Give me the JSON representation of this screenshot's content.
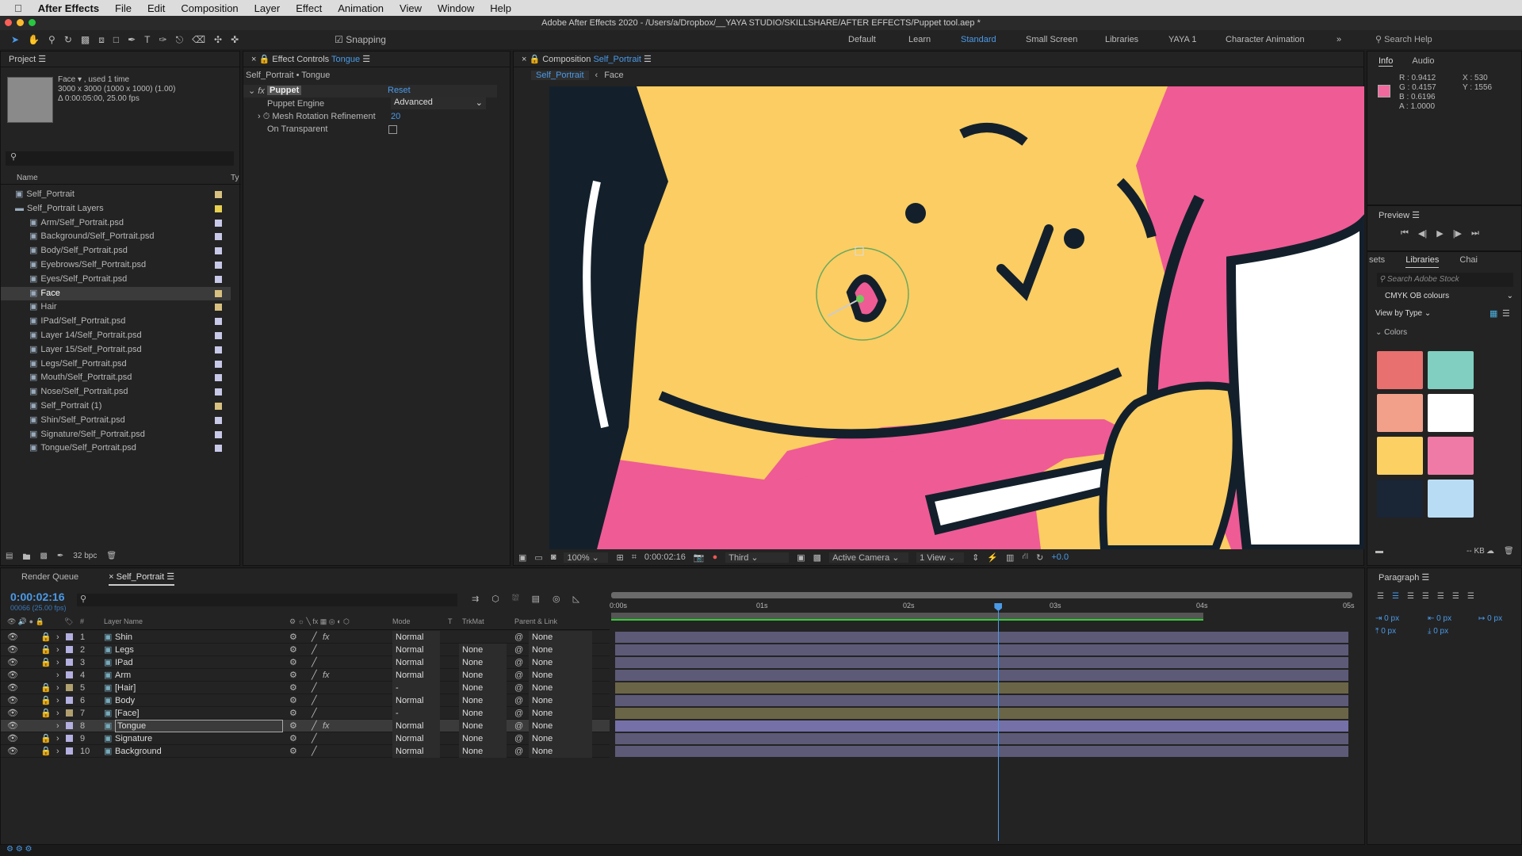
{
  "menu": {
    "apple": "",
    "app": "After Effects",
    "items": [
      "File",
      "Edit",
      "Composition",
      "Layer",
      "Effect",
      "Animation",
      "View",
      "Window",
      "Help"
    ]
  },
  "title": "Adobe After Effects 2020 - /Users/a/Dropbox/__YAYA STUDIO/SKILLSHARE/AFTER EFFECTS/Puppet tool.aep *",
  "toolbar": {
    "snapping": "Snapping",
    "workspaces": [
      "Default",
      "Learn",
      "Standard",
      "Small Screen",
      "Libraries",
      "YAYA 1",
      "Character Animation"
    ],
    "active_workspace": "Standard",
    "search_placeholder": "Search Help"
  },
  "project": {
    "title": "Project",
    "item_name": "Face ▾ , used 1 time",
    "dims": "3000 x 3000  (1000 x 1000) (1.00)",
    "duration": "Δ 0:00:05:00, 25.00 fps",
    "col_name": "Name",
    "col_type": "Ty",
    "bpc": "32 bpc",
    "items": [
      {
        "name": "Self_Portrait",
        "type": "comp",
        "indent": 0,
        "color": "#d8c080"
      },
      {
        "name": "Self_Portrait Layers",
        "type": "folder",
        "indent": 0,
        "color": "#e8d050"
      },
      {
        "name": "Arm/Self_Portrait.psd",
        "type": "psd",
        "indent": 1,
        "color": "#c8c8e8"
      },
      {
        "name": "Background/Self_Portrait.psd",
        "type": "psd",
        "indent": 1,
        "color": "#c8c8e8"
      },
      {
        "name": "Body/Self_Portrait.psd",
        "type": "psd",
        "indent": 1,
        "color": "#c8c8e8"
      },
      {
        "name": "Eyebrows/Self_Portrait.psd",
        "type": "psd",
        "indent": 1,
        "color": "#c8c8e8"
      },
      {
        "name": "Eyes/Self_Portrait.psd",
        "type": "psd",
        "indent": 1,
        "color": "#c8c8e8"
      },
      {
        "name": "Face",
        "type": "comp",
        "indent": 1,
        "color": "#d8c080",
        "selected": true
      },
      {
        "name": "Hair",
        "type": "comp",
        "indent": 1,
        "color": "#d8c080"
      },
      {
        "name": "IPad/Self_Portrait.psd",
        "type": "psd",
        "indent": 1,
        "color": "#c8c8e8"
      },
      {
        "name": "Layer 14/Self_Portrait.psd",
        "type": "psd",
        "indent": 1,
        "color": "#c8c8e8"
      },
      {
        "name": "Layer 15/Self_Portrait.psd",
        "type": "psd",
        "indent": 1,
        "color": "#c8c8e8"
      },
      {
        "name": "Legs/Self_Portrait.psd",
        "type": "psd",
        "indent": 1,
        "color": "#c8c8e8"
      },
      {
        "name": "Mouth/Self_Portrait.psd",
        "type": "psd",
        "indent": 1,
        "color": "#c8c8e8"
      },
      {
        "name": "Nose/Self_Portrait.psd",
        "type": "psd",
        "indent": 1,
        "color": "#c8c8e8"
      },
      {
        "name": "Self_Portrait (1)",
        "type": "comp",
        "indent": 1,
        "color": "#d8c080"
      },
      {
        "name": "Shin/Self_Portrait.psd",
        "type": "psd",
        "indent": 1,
        "color": "#c8c8e8"
      },
      {
        "name": "Signature/Self_Portrait.psd",
        "type": "psd",
        "indent": 1,
        "color": "#c8c8e8"
      },
      {
        "name": "Tongue/Self_Portrait.psd",
        "type": "psd",
        "indent": 1,
        "color": "#c8c8e8"
      }
    ]
  },
  "effect_controls": {
    "title": "Effect Controls",
    "layer": "Tongue",
    "breadcrumb": "Self_Portrait • Tongue",
    "effect": "Puppet",
    "reset": "Reset",
    "engine_label": "Puppet Engine",
    "engine_value": "Advanced",
    "mesh_label": "Mesh Rotation Refinement",
    "mesh_value": "20",
    "transparent_label": "On Transparent"
  },
  "composition": {
    "title": "Composition",
    "comp": "Self_Portrait",
    "crumbs": [
      "Self_Portrait",
      "Face"
    ],
    "zoom": "100%",
    "time": "0:00:02:16",
    "resolution": "Third",
    "camera": "Active Camera",
    "views": "1 View",
    "exposure": "+0.0"
  },
  "info": {
    "tabs": [
      "Info",
      "Audio"
    ],
    "swatch": "#f06a9e",
    "r": "R : 0.9412",
    "g": "G : 0.4157",
    "b": "B : 0.6196",
    "a": "A : 1.0000",
    "x": "X : 530",
    "y": "Y : 1556"
  },
  "preview": {
    "title": "Preview"
  },
  "libraries": {
    "tabs": [
      "sets",
      "Libraries",
      "Chai"
    ],
    "search_placeholder": "Search Adobe Stock",
    "library": "CMYK OB colours",
    "view_by": "View by Type",
    "section": "Colors",
    "colors": [
      "#e8706f",
      "#80cfc0",
      "#f2a08a",
      "#ffffff",
      "#fcd063",
      "#f07aa6",
      "#1a2535",
      "#b9dcf5"
    ],
    "size": "-- KB"
  },
  "timeline": {
    "tabs": [
      "Render Queue",
      "Self_Portrait"
    ],
    "timecode": "0:00:02:16",
    "frames": "00066 (25.00 fps)",
    "headers": {
      "num": "#",
      "name": "Layer Name",
      "mode": "Mode",
      "t": "T",
      "trkmat": "TrkMat",
      "parent": "Parent & Link"
    },
    "ruler": [
      "0:00s",
      "01s",
      "02s",
      "03s",
      "04s",
      "05s"
    ],
    "playhead_seconds": 2.64,
    "duration_seconds": 5,
    "work_area_end_seconds": 4.04,
    "layers": [
      {
        "num": "1",
        "name": "Shin",
        "mode": "Normal",
        "trkmat": "",
        "parent": "None",
        "fx": true,
        "color": "#b4b0e0",
        "locked": true
      },
      {
        "num": "2",
        "name": "Legs",
        "mode": "Normal",
        "trkmat": "None",
        "parent": "None",
        "fx": false,
        "color": "#b4b0e0",
        "locked": true
      },
      {
        "num": "3",
        "name": "IPad",
        "mode": "Normal",
        "trkmat": "None",
        "parent": "None",
        "fx": false,
        "color": "#b4b0e0",
        "locked": true
      },
      {
        "num": "4",
        "name": "Arm",
        "mode": "Normal",
        "trkmat": "None",
        "parent": "None",
        "fx": true,
        "color": "#b4b0e0",
        "locked": false
      },
      {
        "num": "5",
        "name": "[Hair]",
        "mode": "-",
        "trkmat": "None",
        "parent": "None",
        "fx": false,
        "color": "#b0a070",
        "locked": true,
        "comp": true
      },
      {
        "num": "6",
        "name": "Body",
        "mode": "Normal",
        "trkmat": "None",
        "parent": "None",
        "fx": false,
        "color": "#b4b0e0",
        "locked": true
      },
      {
        "num": "7",
        "name": "[Face]",
        "mode": "-",
        "trkmat": "None",
        "parent": "None",
        "fx": false,
        "color": "#b0a070",
        "locked": true,
        "comp": true
      },
      {
        "num": "8",
        "name": "Tongue",
        "mode": "Normal",
        "trkmat": "None",
        "parent": "None",
        "fx": true,
        "color": "#b4b0e0",
        "locked": false,
        "selected": true
      },
      {
        "num": "9",
        "name": "Signature",
        "mode": "Normal",
        "trkmat": "None",
        "parent": "None",
        "fx": false,
        "color": "#b4b0e0",
        "locked": true
      },
      {
        "num": "10",
        "name": "Background",
        "mode": "Normal",
        "trkmat": "None",
        "parent": "None",
        "fx": false,
        "color": "#b4b0e0",
        "locked": true
      }
    ]
  },
  "paragraph": {
    "title": "Paragraph",
    "fields": [
      "0 px",
      "0 px",
      "0 px",
      "0 px",
      "0 px"
    ]
  }
}
